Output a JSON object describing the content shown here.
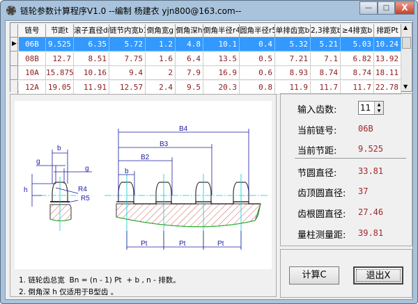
{
  "window": {
    "title": "链轮参数计算程序V1.0  --编制 杨建衣 yjn800@163.com--",
    "minimize": "—",
    "maximize": "□",
    "close": "X"
  },
  "grid": {
    "columns": [
      "链号",
      "节距t",
      "滚子直径dr",
      "链节内宽b1",
      "倒角宽g",
      "倒角深h",
      "倒角半径r4",
      "圆角半径r5",
      "单排齿宽b",
      "2,3排宽b",
      "≥4排宽b",
      "排距Pt"
    ],
    "rows": [
      [
        "06B",
        "9.525",
        "6.35",
        "5.72",
        "1.2",
        "4.8",
        "10.1",
        "0.4",
        "5.32",
        "5.21",
        "5.03",
        "10.24"
      ],
      [
        "08B",
        "12.7",
        "8.51",
        "7.75",
        "1.6",
        "6.4",
        "13.5",
        "0.5",
        "7.21",
        "7.1",
        "6.82",
        "13.92"
      ],
      [
        "10A",
        "15.875",
        "10.16",
        "9.4",
        "2",
        "7.9",
        "16.9",
        "0.6",
        "8.93",
        "8.74",
        "8.74",
        "18.11"
      ],
      [
        "12A",
        "19.05",
        "11.91",
        "12.57",
        "2.4",
        "9.5",
        "20.3",
        "0.8",
        "11.9",
        "11.7",
        "11.7",
        "22.78"
      ]
    ],
    "selected_row": 0
  },
  "diagram": {
    "labels": {
      "b": "b",
      "g": "g",
      "h": "h",
      "r4": "R4",
      "r5": "R5",
      "b2": "B2",
      "b3": "B3",
      "b4": "B4",
      "pt": "Pt"
    }
  },
  "notes": [
    "1. 链轮齿总宽  Bn = (n - 1) Pt  + b , n - 排数。",
    "2. 倒角深 h 仅适用于B型齿 。"
  ],
  "results": {
    "teeth_label": "输入齿数:",
    "teeth_value": "11",
    "chain_label": "当前链号:",
    "chain_value": "06B",
    "pitch_label": "当前节距:",
    "pitch_value": "9.525",
    "pitch_dia_label": "节圆直径:",
    "pitch_dia_value": "33.81",
    "tip_dia_label": "齿顶圆直径:",
    "tip_dia_value": "37",
    "root_dia_label": "齿根圆直径:",
    "root_dia_value": "27.46",
    "pin_dist_label": "量柱测量距:",
    "pin_dist_value": "39.81"
  },
  "buttons": {
    "calc": "计算C",
    "exit": "退出X"
  },
  "colors": {
    "selection": "#3399ff",
    "value_text": "#a0282c",
    "dimension": "#1a1aa0",
    "centerline": "#00cccc",
    "hatch": "#c03030",
    "break_line": "#22bb22"
  }
}
